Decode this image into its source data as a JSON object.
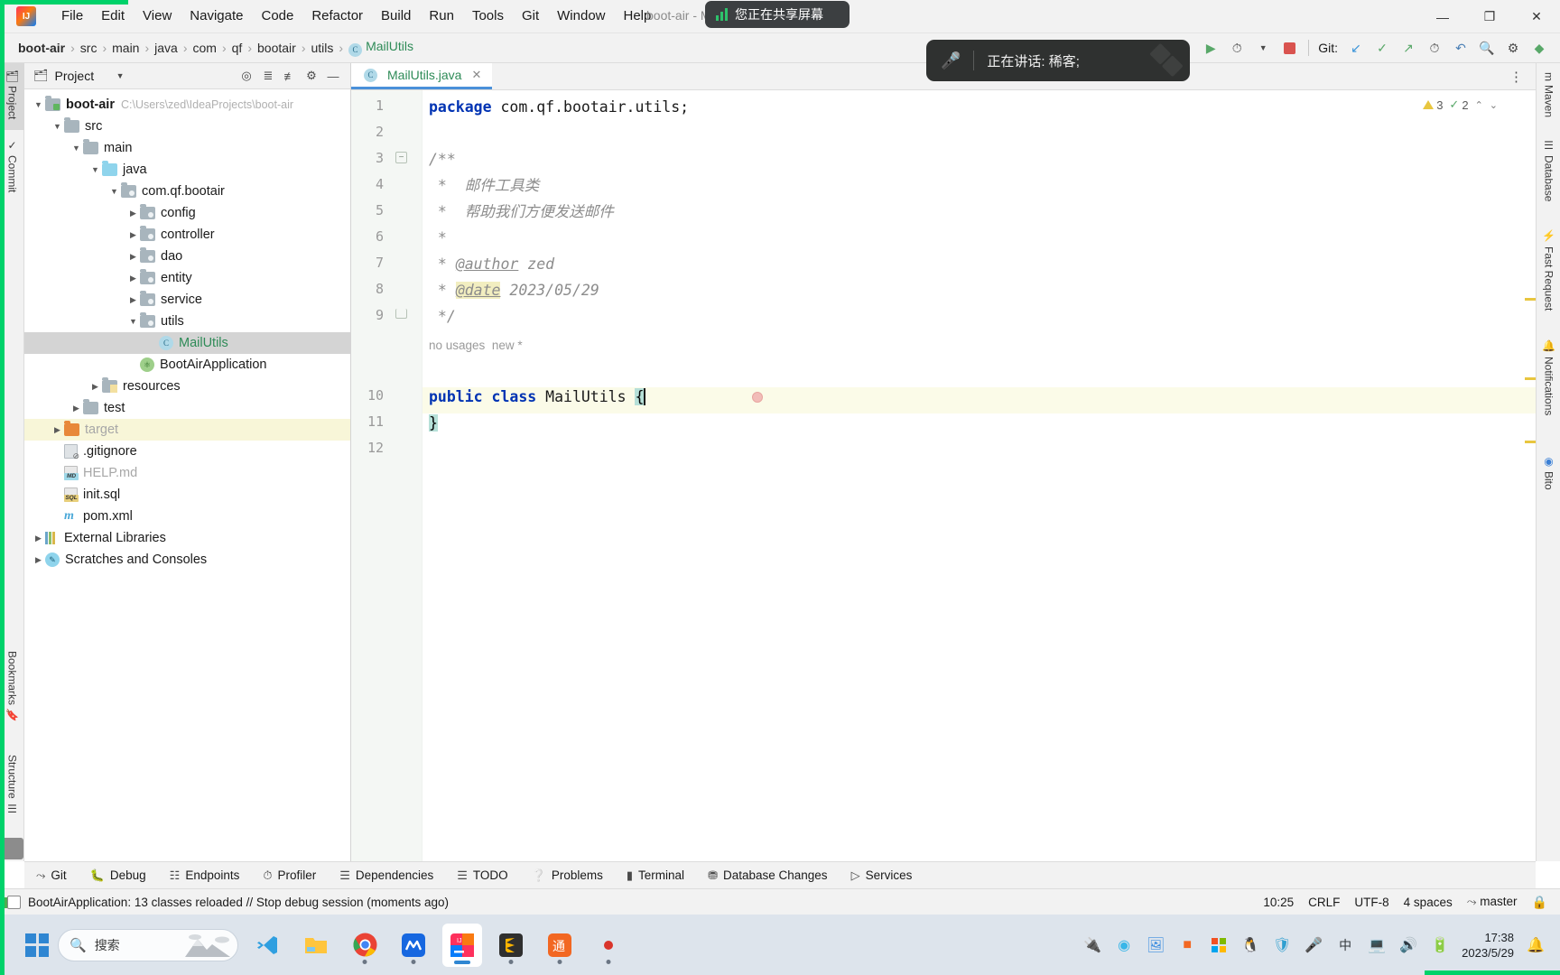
{
  "window": {
    "title": "boot-air - M",
    "controls": {
      "minimize": "—",
      "maximize": "❐",
      "close": "✕"
    }
  },
  "menubar": {
    "items": [
      "File",
      "Edit",
      "View",
      "Navigate",
      "Code",
      "Refactor",
      "Build",
      "Run",
      "Tools",
      "Git",
      "Window",
      "Help"
    ]
  },
  "share_toast": {
    "text": "您正在共享屏幕"
  },
  "speaking_overlay": {
    "text": "正在讲话: 稀客;"
  },
  "breadcrumb": {
    "items": [
      "boot-air",
      "src",
      "main",
      "java",
      "com",
      "qf",
      "bootair",
      "utils"
    ],
    "current": "MailUtils",
    "separator": "›"
  },
  "navbar_right": {
    "git_label": "Git:",
    "icons": [
      "user-avatar-icon",
      "chevron-down-icon",
      "build-hammer-icon",
      "run-icon",
      "debug-icon",
      "coverage-icon",
      "dropdown-icon",
      "stop-icon",
      "git-update-icon",
      "git-commit-icon",
      "git-push-icon",
      "git-history-icon",
      "undo-icon",
      "search-everywhere-icon",
      "settings-icon",
      "ai-icon"
    ]
  },
  "left_strip": {
    "tabs": [
      {
        "label": "Project",
        "icon": "project-icon",
        "selected": true
      },
      {
        "label": "Commit",
        "icon": "commit-icon",
        "selected": false
      },
      {
        "label": "Bookmarks",
        "icon": "bookmark-icon",
        "selected": false
      },
      {
        "label": "Structure",
        "icon": "structure-icon",
        "selected": false
      }
    ]
  },
  "right_strip": {
    "tabs": [
      {
        "label": "Maven",
        "icon": "maven-icon"
      },
      {
        "label": "Database",
        "icon": "database-icon"
      },
      {
        "label": "Fast Request",
        "icon": "fast-request-icon"
      },
      {
        "label": "Notifications",
        "icon": "bell-icon"
      },
      {
        "label": "Bito",
        "icon": "bito-icon"
      }
    ]
  },
  "project_panel": {
    "title": "Project",
    "header_icons": [
      "locate-icon",
      "expand-all-icon",
      "collapse-all-icon",
      "settings-gear-icon",
      "hide-icon"
    ],
    "tree": [
      {
        "depth": 0,
        "arrow": "down",
        "icon": "module-folder",
        "label": "boot-air",
        "bold": true,
        "path": "C:\\Users\\zed\\IdeaProjects\\boot-air"
      },
      {
        "depth": 1,
        "arrow": "down",
        "icon": "folder-grey",
        "label": "src"
      },
      {
        "depth": 2,
        "arrow": "down",
        "icon": "folder-grey",
        "label": "main"
      },
      {
        "depth": 3,
        "arrow": "down",
        "icon": "folder-blue",
        "label": "java"
      },
      {
        "depth": 4,
        "arrow": "down",
        "icon": "package",
        "label": "com.qf.bootair"
      },
      {
        "depth": 5,
        "arrow": "right",
        "icon": "package",
        "label": "config"
      },
      {
        "depth": 5,
        "arrow": "right",
        "icon": "package",
        "label": "controller"
      },
      {
        "depth": 5,
        "arrow": "right",
        "icon": "package",
        "label": "dao"
      },
      {
        "depth": 5,
        "arrow": "right",
        "icon": "package",
        "label": "entity"
      },
      {
        "depth": 5,
        "arrow": "right",
        "icon": "package",
        "label": "service"
      },
      {
        "depth": 5,
        "arrow": "down",
        "icon": "package",
        "label": "utils"
      },
      {
        "depth": 6,
        "arrow": "none",
        "icon": "java-class",
        "label": "MailUtils",
        "selected": true,
        "green": true
      },
      {
        "depth": 5,
        "arrow": "none",
        "icon": "spring-class",
        "label": "BootAirApplication"
      },
      {
        "depth": 3,
        "arrow": "right",
        "icon": "resources-folder",
        "label": "resources"
      },
      {
        "depth": 2,
        "arrow": "right",
        "icon": "folder-grey",
        "label": "test"
      },
      {
        "depth": 1,
        "arrow": "right",
        "icon": "folder-orange",
        "label": "target",
        "highlight": true,
        "grey_label": true
      },
      {
        "depth": 1,
        "arrow": "none",
        "icon": "gitignore-file",
        "label": ".gitignore"
      },
      {
        "depth": 1,
        "arrow": "none",
        "icon": "md-file",
        "label": "HELP.md",
        "grey_label": true
      },
      {
        "depth": 1,
        "arrow": "none",
        "icon": "sql-file",
        "label": "init.sql"
      },
      {
        "depth": 1,
        "arrow": "none",
        "icon": "maven-file",
        "label": "pom.xml"
      },
      {
        "depth": 0,
        "arrow": "right",
        "icon": "library-icon",
        "label": "External Libraries"
      },
      {
        "depth": 0,
        "arrow": "right",
        "icon": "scratches-icon",
        "label": "Scratches and Consoles"
      }
    ]
  },
  "editor": {
    "tab": {
      "label": "MailUtils.java",
      "icon": "java-class-icon",
      "close": "✕"
    },
    "inspections": {
      "warnings": "3",
      "checks": "2",
      "warn_icon": "warning-triangle-icon",
      "check_icon": "checkmark-icon",
      "chevron": "⌃",
      "more": "⌄"
    },
    "hints": {
      "usages": "no usages",
      "new": "new *"
    },
    "lines": [
      {
        "n": "1",
        "tokens": [
          {
            "t": "package ",
            "c": "kw"
          },
          {
            "t": "com.qf.bootair.utils;",
            "c": "pl"
          }
        ]
      },
      {
        "n": "2",
        "tokens": []
      },
      {
        "n": "3",
        "tokens": [
          {
            "t": "/**",
            "c": "cmt"
          }
        ],
        "fold": "minus"
      },
      {
        "n": "4",
        "tokens": [
          {
            "t": " *  邮件工具类",
            "c": "cmt"
          }
        ]
      },
      {
        "n": "5",
        "tokens": [
          {
            "t": " *  帮助我们方便发送邮件",
            "c": "cmt"
          }
        ]
      },
      {
        "n": "6",
        "tokens": [
          {
            "t": " *",
            "c": "cmt"
          }
        ]
      },
      {
        "n": "7",
        "tokens": [
          {
            "t": " * ",
            "c": "cmt"
          },
          {
            "t": "@author",
            "c": "tagk"
          },
          {
            "t": " zed",
            "c": "cmt"
          }
        ]
      },
      {
        "n": "8",
        "tokens": [
          {
            "t": " * ",
            "c": "cmt"
          },
          {
            "t": "@date",
            "c": "tagk-hl"
          },
          {
            "t": " 2023/05/29",
            "c": "cmt"
          }
        ]
      },
      {
        "n": "9",
        "tokens": [
          {
            "t": " */",
            "c": "cmt"
          }
        ],
        "fold": "end"
      },
      {
        "n": "10",
        "tokens": [
          {
            "t": "public class ",
            "c": "kw"
          },
          {
            "t": "MailUtils ",
            "c": "clsname"
          },
          {
            "t": "{",
            "c": "brace"
          }
        ],
        "current": true
      },
      {
        "n": "11",
        "tokens": [
          {
            "t": "}",
            "c": "brace"
          }
        ]
      },
      {
        "n": "12",
        "tokens": []
      }
    ]
  },
  "bottom_bar": {
    "items": [
      {
        "label": "Git",
        "icon": "git-branch-icon"
      },
      {
        "label": "Debug",
        "icon": "debug-bug-icon"
      },
      {
        "label": "Endpoints",
        "icon": "endpoints-icon"
      },
      {
        "label": "Profiler",
        "icon": "profiler-icon"
      },
      {
        "label": "Dependencies",
        "icon": "dependencies-icon"
      },
      {
        "label": "TODO",
        "icon": "todo-list-icon"
      },
      {
        "label": "Problems",
        "icon": "problems-icon"
      },
      {
        "label": "Terminal",
        "icon": "terminal-icon"
      },
      {
        "label": "Database Changes",
        "icon": "database-changes-icon"
      },
      {
        "label": "Services",
        "icon": "services-icon"
      }
    ]
  },
  "statusbar": {
    "message": "BootAirApplication: 13 classes reloaded // Stop debug session (moments ago)",
    "caret": "10:25",
    "line_separator": "CRLF",
    "encoding": "UTF-8",
    "indent": "4 spaces",
    "branch": "master",
    "branch_icon": "git-branch-icon",
    "lock_icon": "lock-icon"
  },
  "taskbar": {
    "search_placeholder": "搜索",
    "search_icon": "search-icon",
    "apps": [
      {
        "name": "vscode-icon",
        "glyph": "X",
        "running": false
      },
      {
        "name": "file-explorer-icon",
        "glyph": "",
        "running": false
      },
      {
        "name": "chrome-icon",
        "glyph": "",
        "running": true
      },
      {
        "name": "navicat-icon",
        "glyph": "M",
        "running": true
      },
      {
        "name": "intellij-idea-icon",
        "glyph": "IJ",
        "running": true,
        "active": true
      },
      {
        "name": "sublime-icon",
        "glyph": "S",
        "running": true
      },
      {
        "name": "tongyi-icon",
        "glyph": "通",
        "running": true
      },
      {
        "name": "redspot-icon",
        "glyph": "",
        "running": true
      }
    ],
    "tray": [
      "usb-icon",
      "bluetooth-icon",
      "picture-icon",
      "app-orange-icon",
      "microsoft-icon",
      "qq-penguin-icon",
      "security-shield-icon",
      "microphone-icon",
      "ime-chinese-icon",
      "display-icon",
      "volume-icon",
      "battery-icon"
    ],
    "clock_time": "17:38",
    "clock_date": "2023/5/29",
    "notification_icon": "notification-bell-icon"
  },
  "colors": {
    "accent_blue": "#4a90d9",
    "share_green": "#00d26a",
    "keyword_blue": "#0033b3",
    "comment_grey": "#8c8c8c",
    "class_green": "#2e8b57",
    "highlight_yellow": "#f8f6d8"
  }
}
